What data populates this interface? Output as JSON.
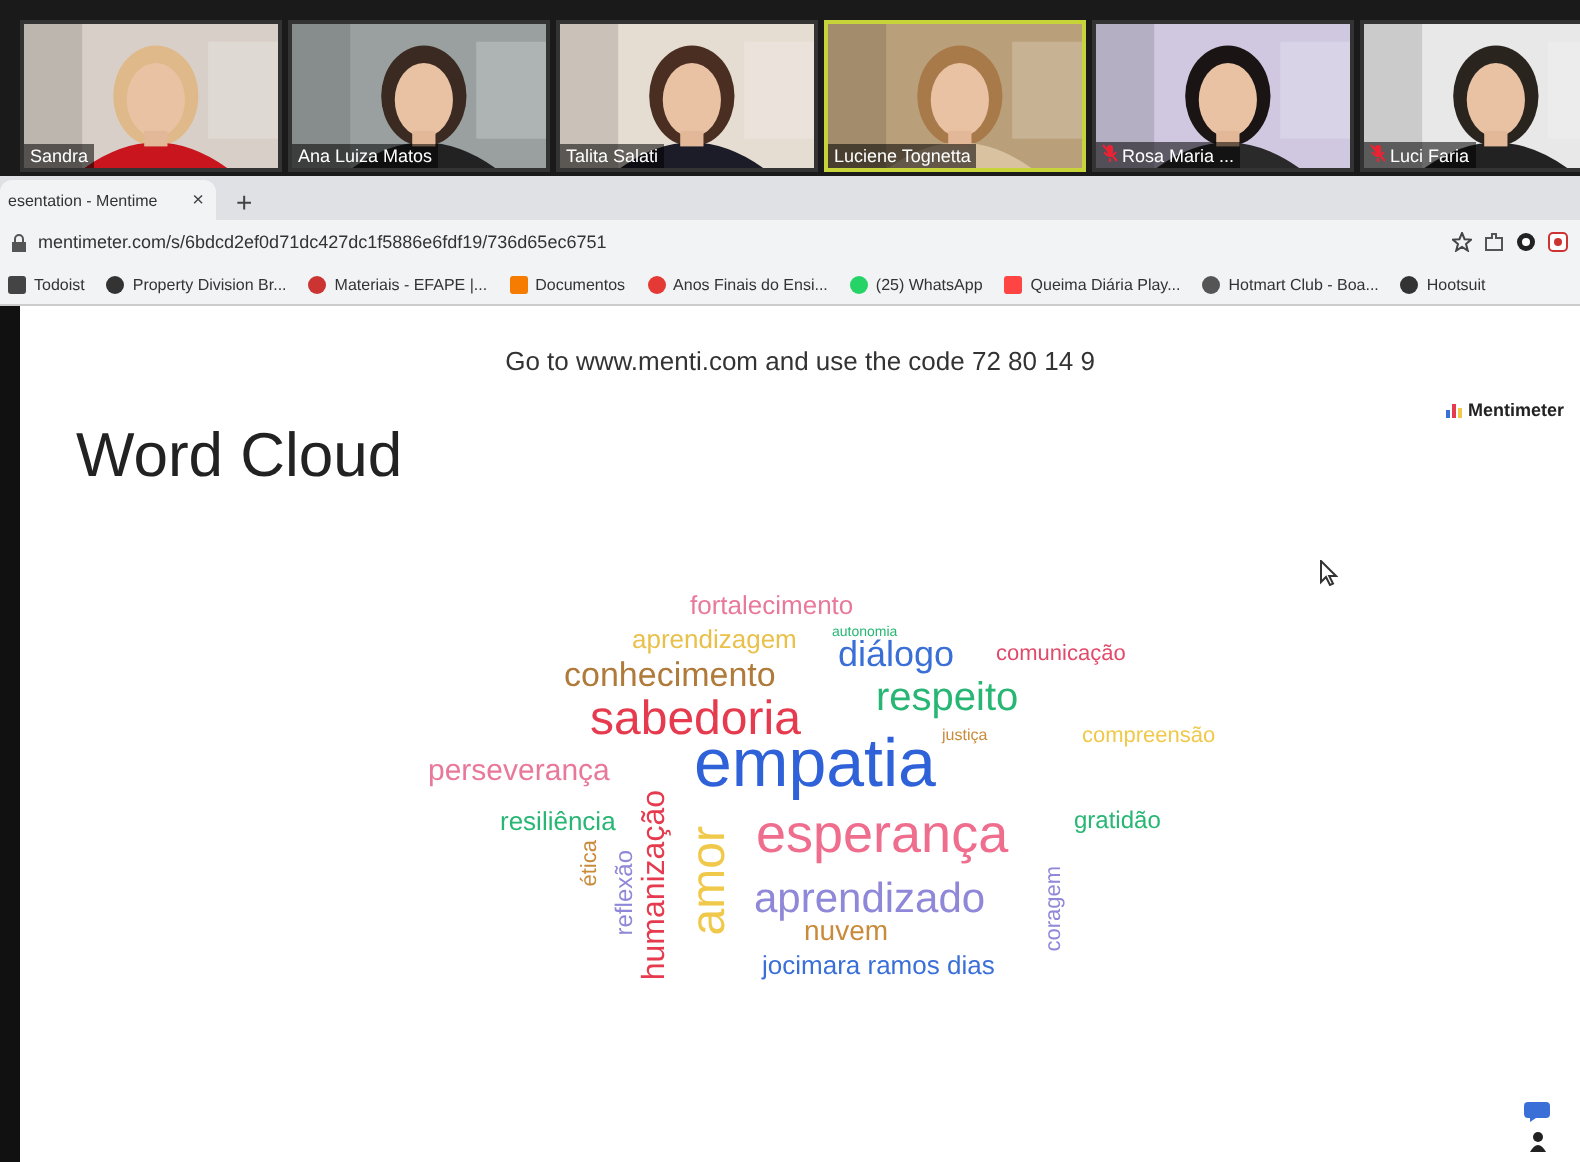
{
  "participants": [
    {
      "name": "Sandra",
      "muted": false,
      "speaking": false
    },
    {
      "name": "Ana Luiza Matos",
      "muted": false,
      "speaking": false
    },
    {
      "name": "Talita Salati",
      "muted": false,
      "speaking": false
    },
    {
      "name": "Luciene Tognetta",
      "muted": false,
      "speaking": true
    },
    {
      "name": "Rosa Maria ...",
      "muted": true,
      "speaking": false
    },
    {
      "name": "Luci Faria",
      "muted": true,
      "speaking": false
    }
  ],
  "browser": {
    "tab": {
      "title": "esentation - Mentime",
      "close": "×"
    },
    "new_tab": "+",
    "url": "mentimeter.com/s/6bdcd2ef0d71dc427dc1f5886e6fdf19/736d65ec6751",
    "bookmarks": [
      {
        "label": "Todoist"
      },
      {
        "label": "Property Division Br..."
      },
      {
        "label": "Materiais - EFAPE |..."
      },
      {
        "label": "Documentos"
      },
      {
        "label": "Anos Finais do Ensi..."
      },
      {
        "label": "(25) WhatsApp"
      },
      {
        "label": "Queima Diária Play..."
      },
      {
        "label": "Hotmart Club - Boa..."
      },
      {
        "label": "Hootsuit"
      }
    ]
  },
  "slide": {
    "instructions": "Go to www.menti.com and use the code 72 80 14 9",
    "title": "Word Cloud",
    "brand": "Mentimeter",
    "words": [
      {
        "text": "fortalecimento",
        "color": "#e8799a",
        "kind": "horizontal"
      },
      {
        "text": "aprendizagem",
        "color": "#e8c04a",
        "kind": "horizontal"
      },
      {
        "text": "autonomia",
        "color": "#27b673",
        "kind": "horizontal"
      },
      {
        "text": "diálogo",
        "color": "#3a6fd8",
        "kind": "horizontal"
      },
      {
        "text": "comunicação",
        "color": "#e24a6a",
        "kind": "horizontal"
      },
      {
        "text": "conhecimento",
        "color": "#b07a3a",
        "kind": "horizontal"
      },
      {
        "text": "respeito",
        "color": "#27b673",
        "kind": "horizontal"
      },
      {
        "text": "sabedoria",
        "color": "#e63b4e",
        "kind": "horizontal"
      },
      {
        "text": "justiça",
        "color": "#c98a3a",
        "kind": "horizontal"
      },
      {
        "text": "compreensão",
        "color": "#f0c94a",
        "kind": "horizontal"
      },
      {
        "text": "perseverança",
        "color": "#e8799a",
        "kind": "horizontal"
      },
      {
        "text": "empatia",
        "color": "#2f62d8",
        "kind": "horizontal"
      },
      {
        "text": "resiliência",
        "color": "#27b673",
        "kind": "horizontal"
      },
      {
        "text": "ética",
        "color": "#c98a3a",
        "kind": "vertical"
      },
      {
        "text": "reflexão",
        "color": "#8f88d8",
        "kind": "vertical"
      },
      {
        "text": "humanização",
        "color": "#e63b4e",
        "kind": "vertical"
      },
      {
        "text": "amor",
        "color": "#f0c94a",
        "kind": "vertical"
      },
      {
        "text": "esperança",
        "color": "#ef6e8e",
        "kind": "horizontal"
      },
      {
        "text": "gratidão",
        "color": "#27b673",
        "kind": "horizontal"
      },
      {
        "text": "aprendizado",
        "color": "#8f88d8",
        "kind": "horizontal"
      },
      {
        "text": "coragem",
        "color": "#8f88d8",
        "kind": "vertical"
      },
      {
        "text": "nuvem",
        "color": "#c98a3a",
        "kind": "horizontal"
      },
      {
        "text": "jocimara ramos dias",
        "color": "#3a6fd8",
        "kind": "horizontal"
      }
    ]
  }
}
